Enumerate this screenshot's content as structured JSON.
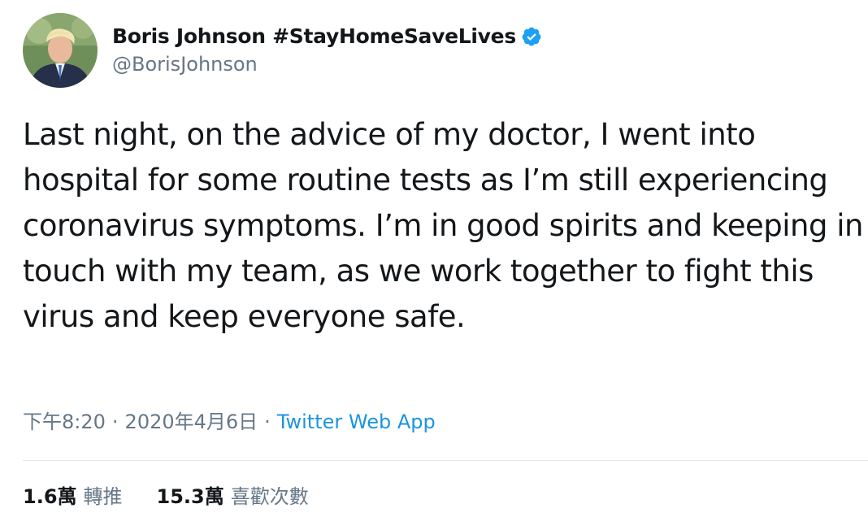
{
  "author": {
    "display_name": "Boris Johnson #StayHomeSaveLives",
    "handle": "@BorisJohnson",
    "verified_icon": "verified-badge-icon",
    "avatar_icon": "avatar"
  },
  "tweet": {
    "text": "Last night, on the advice of my doctor, I went into hospital for some routine tests as I’m still experiencing coronavirus symptoms. I’m in good spirits and keeping in touch with my team, as we work together to fight this virus and keep everyone safe."
  },
  "meta": {
    "time": "下午8:20",
    "separator": "·",
    "date": "2020年4月6日",
    "app": "Twitter Web App"
  },
  "stats": {
    "retweets_count": "1.6萬",
    "retweets_label": "轉推",
    "likes_count": "15.3萬",
    "likes_label": "喜歡次數"
  },
  "colors": {
    "primary_text": "#14171a",
    "secondary_text": "#657786",
    "link": "#1b95e0",
    "verified": "#1da1f2",
    "divider": "#e1e8ed"
  }
}
